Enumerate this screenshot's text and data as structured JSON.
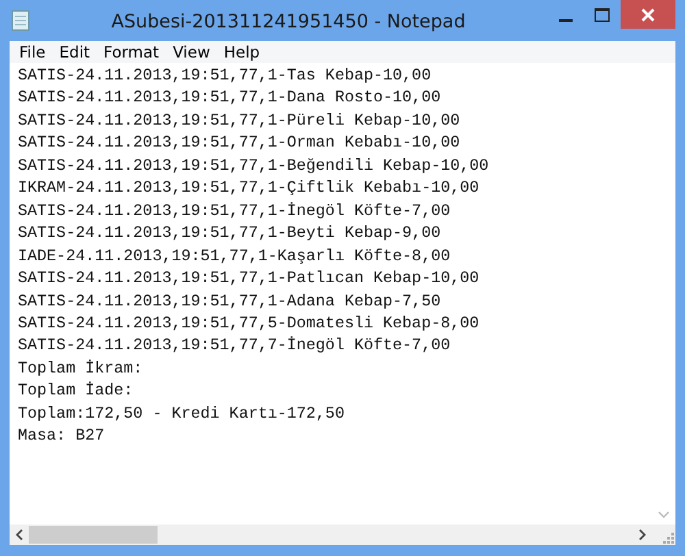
{
  "window": {
    "title": "ASubesi-201311241951450 - Notepad"
  },
  "menu": [
    "File",
    "Edit",
    "Format",
    "View",
    "Help"
  ],
  "lines": [
    "SATIS-24.11.2013,19:51,77,1-Tas Kebap-10,00",
    "SATIS-24.11.2013,19:51,77,1-Dana Rosto-10,00",
    "SATIS-24.11.2013,19:51,77,1-Püreli Kebap-10,00",
    "SATIS-24.11.2013,19:51,77,1-Orman Kebabı-10,00",
    "SATIS-24.11.2013,19:51,77,1-Beğendili Kebap-10,00",
    "IKRAM-24.11.2013,19:51,77,1-Çiftlik Kebabı-10,00",
    "SATIS-24.11.2013,19:51,77,1-İnegöl Köfte-7,00",
    "SATIS-24.11.2013,19:51,77,1-Beyti Kebap-9,00",
    "IADE-24.11.2013,19:51,77,1-Kaşarlı Köfte-8,00",
    "SATIS-24.11.2013,19:51,77,1-Patlıcan Kebap-10,00",
    "SATIS-24.11.2013,19:51,77,1-Adana Kebap-7,50",
    "SATIS-24.11.2013,19:51,77,5-Domatesli Kebap-8,00",
    "SATIS-24.11.2013,19:51,77,7-İnegöl Köfte-7,00",
    "Toplam İkram:",
    "Toplam İade:",
    "Toplam:172,50 - Kredi Kartı-172,50",
    "Masa: B27"
  ]
}
